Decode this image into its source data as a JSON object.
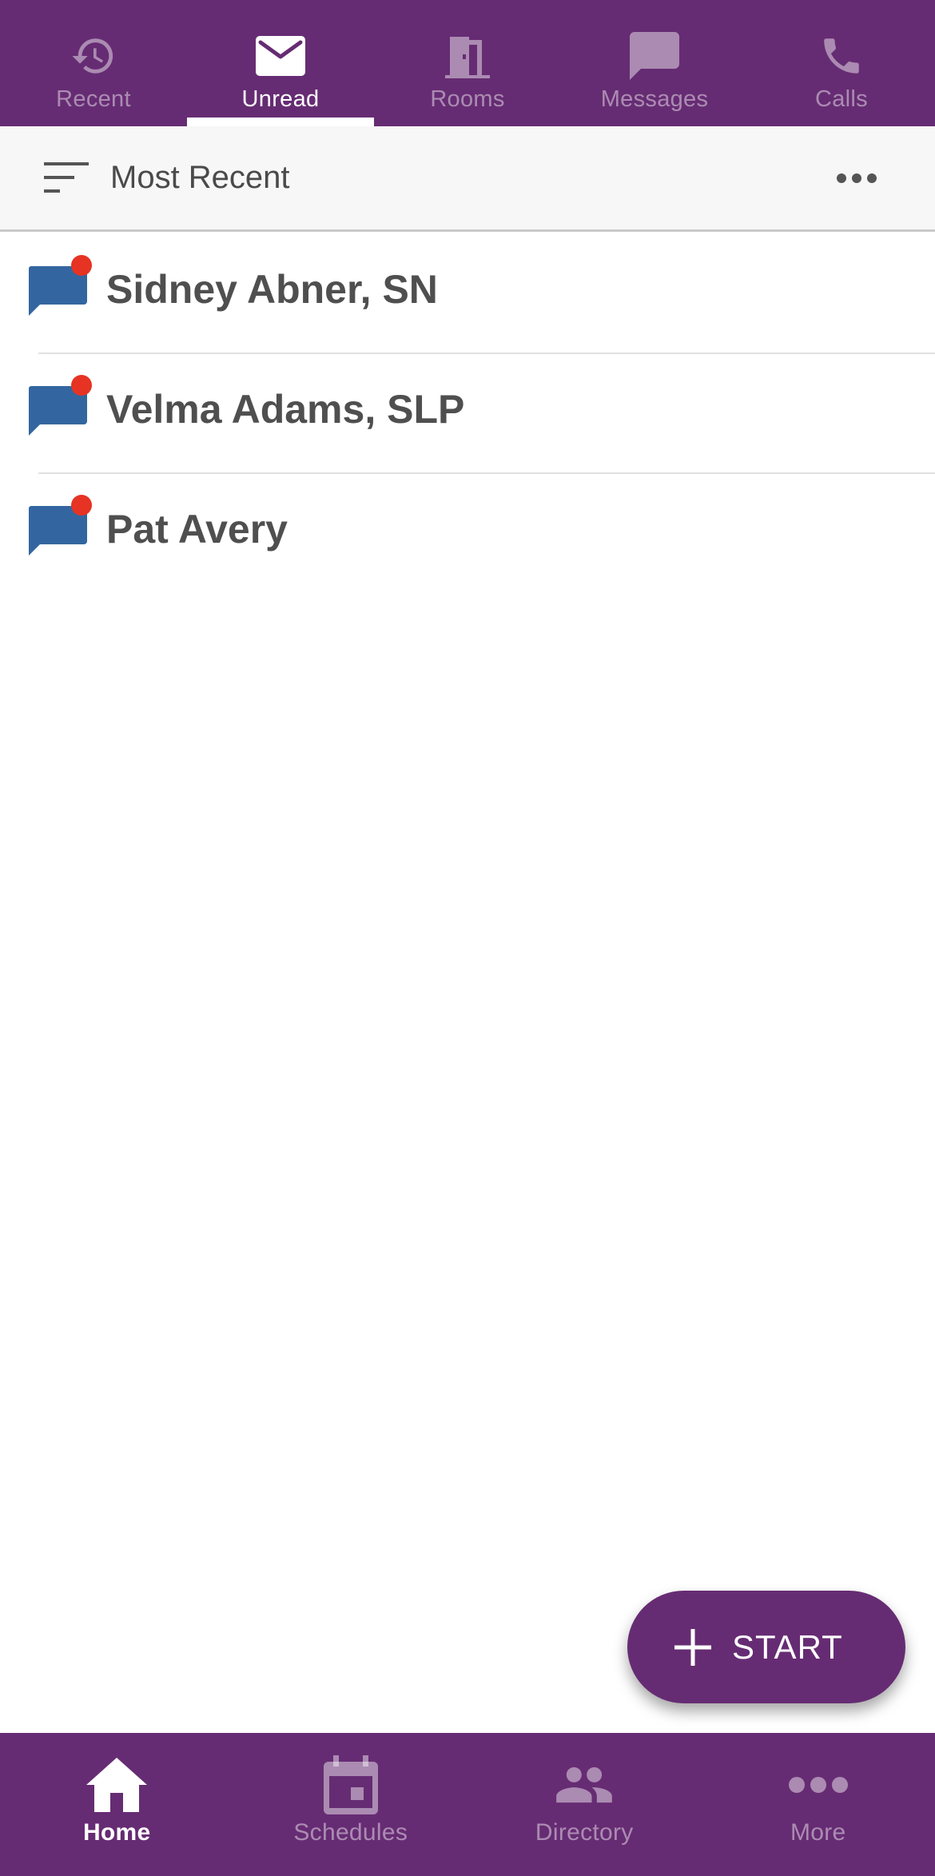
{
  "top_tabs": [
    {
      "label": "Recent",
      "icon": "history-icon",
      "active": false
    },
    {
      "label": "Unread",
      "icon": "mail-icon",
      "active": true
    },
    {
      "label": "Rooms",
      "icon": "door-icon",
      "active": false
    },
    {
      "label": "Messages",
      "icon": "chat-bubble-icon",
      "active": false
    },
    {
      "label": "Calls",
      "icon": "phone-icon",
      "active": false
    }
  ],
  "sort_bar": {
    "label": "Most Recent",
    "sort_icon": "sort-icon",
    "more_icon": "more-horizontal-icon"
  },
  "conversations": [
    {
      "name": "Sidney Abner, SN",
      "icon": "chat-unread-icon",
      "unread": true
    },
    {
      "name": "Velma Adams, SLP",
      "icon": "chat-unread-icon",
      "unread": true
    },
    {
      "name": "Pat Avery",
      "icon": "chat-unread-icon",
      "unread": true
    }
  ],
  "fab": {
    "label": "START",
    "icon": "plus-icon"
  },
  "bottom_nav": [
    {
      "label": "Home",
      "icon": "home-icon",
      "active": true
    },
    {
      "label": "Schedules",
      "icon": "calendar-icon",
      "active": false
    },
    {
      "label": "Directory",
      "icon": "people-icon",
      "active": false
    },
    {
      "label": "More",
      "icon": "more-horizontal-icon",
      "active": false
    }
  ],
  "colors": {
    "brand_purple": "#662c73",
    "chat_blue": "#3366a0",
    "unread_red": "#e63323",
    "text_dark": "#4f4f4f"
  }
}
